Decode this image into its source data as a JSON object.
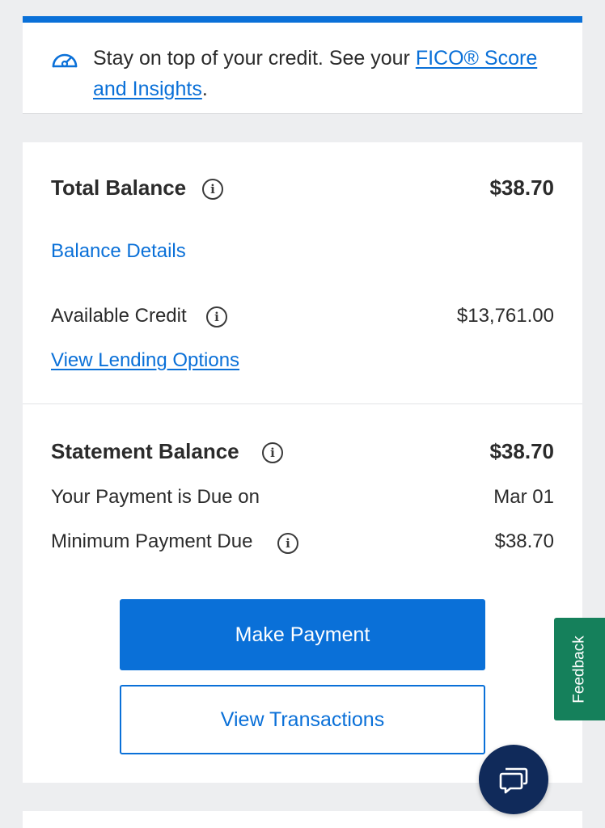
{
  "fico_banner": {
    "text_before": "Stay on top of your credit. See your ",
    "link_text": "FICO® Score and Insights",
    "text_after": ".",
    "icon": "speedometer-icon"
  },
  "balance": {
    "total_label": "Total Balance",
    "total_value": "$38.70",
    "details_link": "Balance Details",
    "available_label": "Available Credit",
    "available_value": "$13,761.00",
    "lending_link": "View Lending Options"
  },
  "statement": {
    "label": "Statement Balance",
    "value": "$38.70",
    "due_label": "Your Payment is Due on",
    "due_value": "Mar 01",
    "minimum_label": "Minimum Payment Due",
    "minimum_value": "$38.70"
  },
  "actions": {
    "make_payment": "Make Payment",
    "view_transactions": "View Transactions"
  },
  "feedback_tab": {
    "label": "Feedback"
  },
  "info_icon_glyph": "i",
  "chat_button": {
    "icon": "chat-bubbles-icon"
  },
  "colors": {
    "accent": "#0a70d8",
    "feedback_green": "#15805b",
    "chat_navy": "#102a5a",
    "page_background": "#edeef0"
  }
}
